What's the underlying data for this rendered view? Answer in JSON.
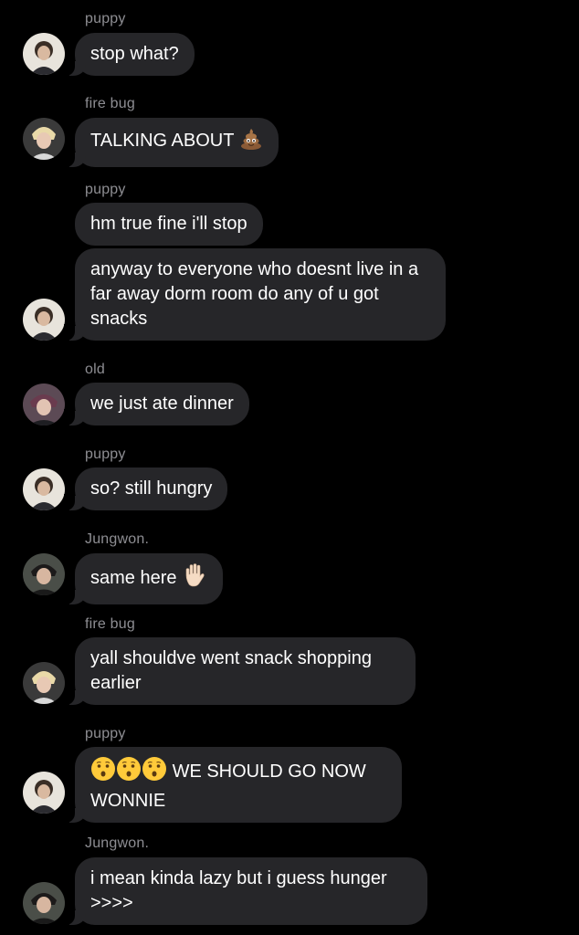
{
  "messages": [
    {
      "sender": "puppy",
      "text": "stop what?",
      "emoji": ""
    },
    {
      "sender": "fire bug",
      "text": "TALKING ABOUT",
      "emoji": "poop-emoji"
    },
    {
      "sender": "puppy",
      "text": "hm true fine i'll stop",
      "emoji": ""
    },
    {
      "sender": "",
      "text": "anyway to everyone who doesnt live in a far away dorm room do any of u got snacks",
      "emoji": ""
    },
    {
      "sender": "old",
      "text": "we just ate dinner",
      "emoji": ""
    },
    {
      "sender": "puppy",
      "text": "so? still hungry",
      "emoji": ""
    },
    {
      "sender": "Jungwon.",
      "text": "same here",
      "emoji": "raised-hand-emoji"
    },
    {
      "sender": "fire bug",
      "text": "yall shouldve went snack shopping earlier",
      "emoji": ""
    },
    {
      "sender": "puppy",
      "text": "WE SHOULD GO NOW WONNIE",
      "emoji": "hushed-face-emoji x3"
    },
    {
      "sender": "Jungwon.",
      "text": "i mean kinda lazy but i guess hunger >>>>",
      "emoji": ""
    }
  ],
  "colors": {
    "background": "#000000",
    "bubble": "#262629",
    "sender_text": "#8e8e93",
    "message_text": "#ffffff"
  }
}
